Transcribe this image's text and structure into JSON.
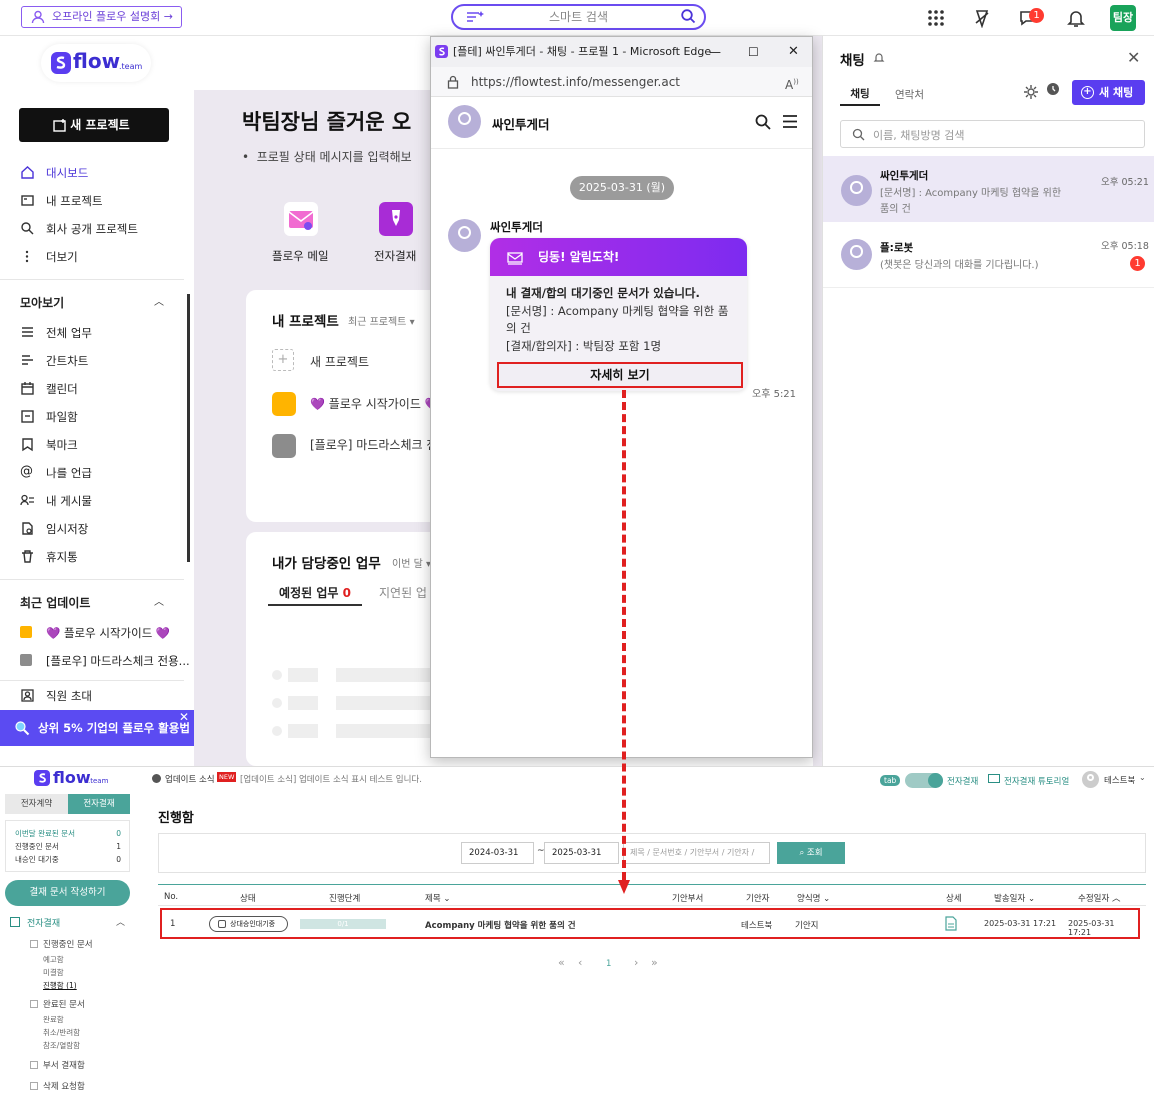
{
  "topbar": {
    "promo_label": "오프라인 플로우 설명회 →",
    "search_label": "스마트 검색",
    "notification_count": "1",
    "profile_label": "팀장"
  },
  "sidebar": {
    "new_project": "새 프로젝트",
    "nav": [
      "대시보드",
      "내 프로젝트",
      "회사 공개 프로젝트",
      "더보기"
    ],
    "collection_title": "모아보기",
    "collection": [
      "전체 업무",
      "간트차트",
      "캘린더",
      "파일함",
      "북마크",
      "나를 언급",
      "내 게시물",
      "임시저장",
      "휴지통"
    ],
    "recent_title": "최근 업데이트",
    "recent": [
      "💜 플로우 시작가이드 💜",
      "[플로우] 마드라스체크 전용..."
    ],
    "invite": "직원 초대",
    "banner": "상위 5% 기업의 플로우 활용법"
  },
  "dashboard": {
    "greeting": "박팀장님 즐거운 오",
    "status_msg": "프로필 상태 메시지를 입력해보",
    "apps": [
      "플로우 메일",
      "전자결재"
    ],
    "my_projects_title": "내 프로젝트",
    "my_projects_sub": "최근 프로젝트",
    "new_project": "새 프로젝트",
    "projects": [
      "💜 플로우 시작가이드 💜",
      "[플로우] 마드라스체크 전"
    ],
    "tasks_title": "내가 담당중인 업무",
    "tasks_sub": "이번 달",
    "tab_scheduled": "예정된 업무",
    "tab_scheduled_count": "0",
    "tab_delayed": "지연된 업"
  },
  "edge": {
    "window_title": "[플테] 싸인투게더 - 채팅 - 프로필 1 - Microsoft Edge",
    "url": "https://flowtest.info/messenger.act",
    "chat_name": "싸인투게더",
    "date": "2025-03-31 (월)",
    "sender": "싸인투게더",
    "card_title": "딩동! 알림도착!",
    "card_line1": "내 결재/합의 대기중인 문서가 있습니다.",
    "card_line2": "[문서명] : Acompany 마케팅 협약을 위한 품",
    "card_line3": "의 건",
    "card_line4": "[결재/합의자] : 박팀장 포함 1명",
    "detail_btn": "자세히 보기",
    "time": "오후 5:21"
  },
  "chat_panel": {
    "title": "채팅",
    "tab_chat": "채팅",
    "tab_contacts": "연락처",
    "new_chat": "새 채팅",
    "search_placeholder": "이름, 채팅방명 검색",
    "items": [
      {
        "name": "싸인투게더",
        "msg1": "[문서명] : Acompany 마케팅 협약을 위한",
        "msg2": "품의 건",
        "time": "오후 05:21",
        "unread": ""
      },
      {
        "name": "플:로봇",
        "msg1": "(챗봇은 당신과의 대화를 기다립니다.)",
        "msg2": "",
        "time": "오후 05:18",
        "unread": "1"
      }
    ]
  },
  "approval": {
    "tab_contract": "전자계약",
    "tab_approval": "전자결재",
    "stats": [
      {
        "label": "이번달 완료된 문서",
        "value": "0"
      },
      {
        "label": "진행중인 문서",
        "value": "1"
      },
      {
        "label": "내승인 대기중",
        "value": "0"
      }
    ],
    "write_btn": "결재 문서 작성하기",
    "tree_root": "전자결재",
    "tree_inprogress": "진행중인 문서",
    "tree_inprogress_items": [
      "예고함",
      "미결함",
      "진행함 (1)"
    ],
    "tree_done": "완료된 문서",
    "tree_done_items": [
      "완료함",
      "취소/반려함",
      "참조/열람함"
    ],
    "tree_dept": "부서 결재함",
    "tree_delete": "삭제 요청함",
    "notice_label": "업데이트 소식",
    "notice_new": "NEW",
    "notice_text": "[업데이트 소식] 업데이트 소식 표시 테스트 입니다.",
    "tab_badge": "tab",
    "toggle_label": "전자결재",
    "tutorial": "전자결재 튜토리얼",
    "user": "테스트북",
    "page_title": "진행함",
    "date_from": "2024-03-31",
    "date_to": "2025-03-31",
    "search_placeholder": "제목 / 문서번호 / 기안부서 / 기안자 /",
    "search_btn": "조회",
    "columns": [
      "No.",
      "상태",
      "진행단계",
      "제목",
      "기안부서",
      "기안자",
      "양식명",
      "상세",
      "발송일자",
      "수정일자"
    ],
    "row": {
      "no": "1",
      "status": "상대승인대기중",
      "progress_text": "0/1",
      "progress": 0,
      "title": "Acompany 마케팅 협약을 위한 품의 건",
      "dept": "",
      "drafter": "테스트북",
      "form": "기안지",
      "sent": "2025-03-31 17:21",
      "modified": "2025-03-31 17:21"
    },
    "page": "1"
  }
}
